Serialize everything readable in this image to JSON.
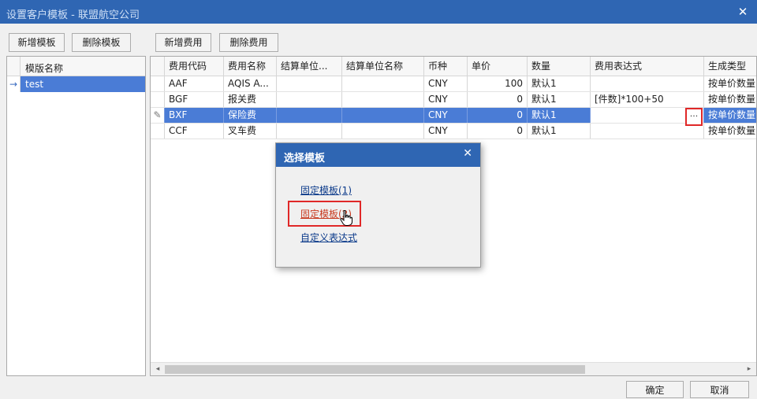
{
  "window": {
    "title": "设置客户模板 - 联盟航空公司",
    "close_glyph": "✕"
  },
  "toolbar_left": {
    "add_template": "新增模板",
    "delete_template": "删除模板"
  },
  "toolbar_right": {
    "add_fee": "新增费用",
    "delete_fee": "删除费用"
  },
  "template_list": {
    "header": "模版名称",
    "rows": [
      {
        "name": "test",
        "selected": true
      }
    ]
  },
  "fee_grid": {
    "columns": [
      "费用代码",
      "费用名称",
      "结算单位...",
      "结算单位名称",
      "币种",
      "单价",
      "数量",
      "费用表达式",
      "生成类型"
    ],
    "rows": [
      {
        "code": "AAF",
        "name": "AQIS A...",
        "unit": "",
        "unit_name": "",
        "currency": "CNY",
        "price": "100",
        "qty": "默认1",
        "expr": "",
        "type": "按单价数量"
      },
      {
        "code": "BGF",
        "name": "报关费",
        "unit": "",
        "unit_name": "",
        "currency": "CNY",
        "price": "0",
        "qty": "默认1",
        "expr": "[件数]*100+50",
        "type": "按单价数量"
      },
      {
        "code": "BXF",
        "name": "保险费",
        "unit": "",
        "unit_name": "",
        "currency": "CNY",
        "price": "0",
        "qty": "默认1",
        "expr": "",
        "type": "按单价数量"
      },
      {
        "code": "CCF",
        "name": "叉车费",
        "unit": "",
        "unit_name": "",
        "currency": "CNY",
        "price": "0",
        "qty": "默认1",
        "expr": "",
        "type": "按单价数量"
      }
    ],
    "selected_row": 2,
    "edit_indicator_glyph": "✎",
    "ellipsis_label": "···"
  },
  "popup": {
    "title": "选择模板",
    "close_glyph": "✕",
    "options": [
      "固定模板(1)",
      "固定模板(2)",
      "自定义表达式"
    ],
    "active_option": 1
  },
  "footer": {
    "ok": "确定",
    "cancel": "取消"
  },
  "icons": {
    "row_pointer": "→",
    "scroll_left": "◂",
    "scroll_right": "▸"
  },
  "colors": {
    "titlebar": "#2f66b3",
    "selection": "#4a7cd6",
    "highlight_border": "#e02828",
    "link": "#0b3a8a",
    "link_active": "#c83a20"
  }
}
